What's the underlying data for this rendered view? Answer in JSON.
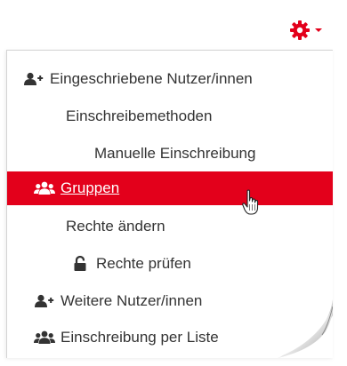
{
  "colors": {
    "accent": "#e3001b",
    "text": "#333333",
    "active_text": "#ffffff"
  },
  "menu": {
    "items": [
      {
        "label": "Eingeschriebene Nutzer/innen",
        "icon": "user-plus-icon",
        "active": false
      },
      {
        "label": "Einschreibemethoden",
        "icon": "",
        "active": false
      },
      {
        "label": "Manuelle Einschreibung",
        "icon": "",
        "active": false
      },
      {
        "label": "Gruppen",
        "icon": "users-icon",
        "active": true
      },
      {
        "label": "Rechte ändern",
        "icon": "",
        "active": false
      },
      {
        "label": "Rechte prüfen",
        "icon": "unlock-icon",
        "active": false
      },
      {
        "label": "Weitere Nutzer/innen",
        "icon": "user-plus-icon",
        "active": false
      },
      {
        "label": "Einschreibung per Liste",
        "icon": "users-icon",
        "active": false
      }
    ]
  }
}
